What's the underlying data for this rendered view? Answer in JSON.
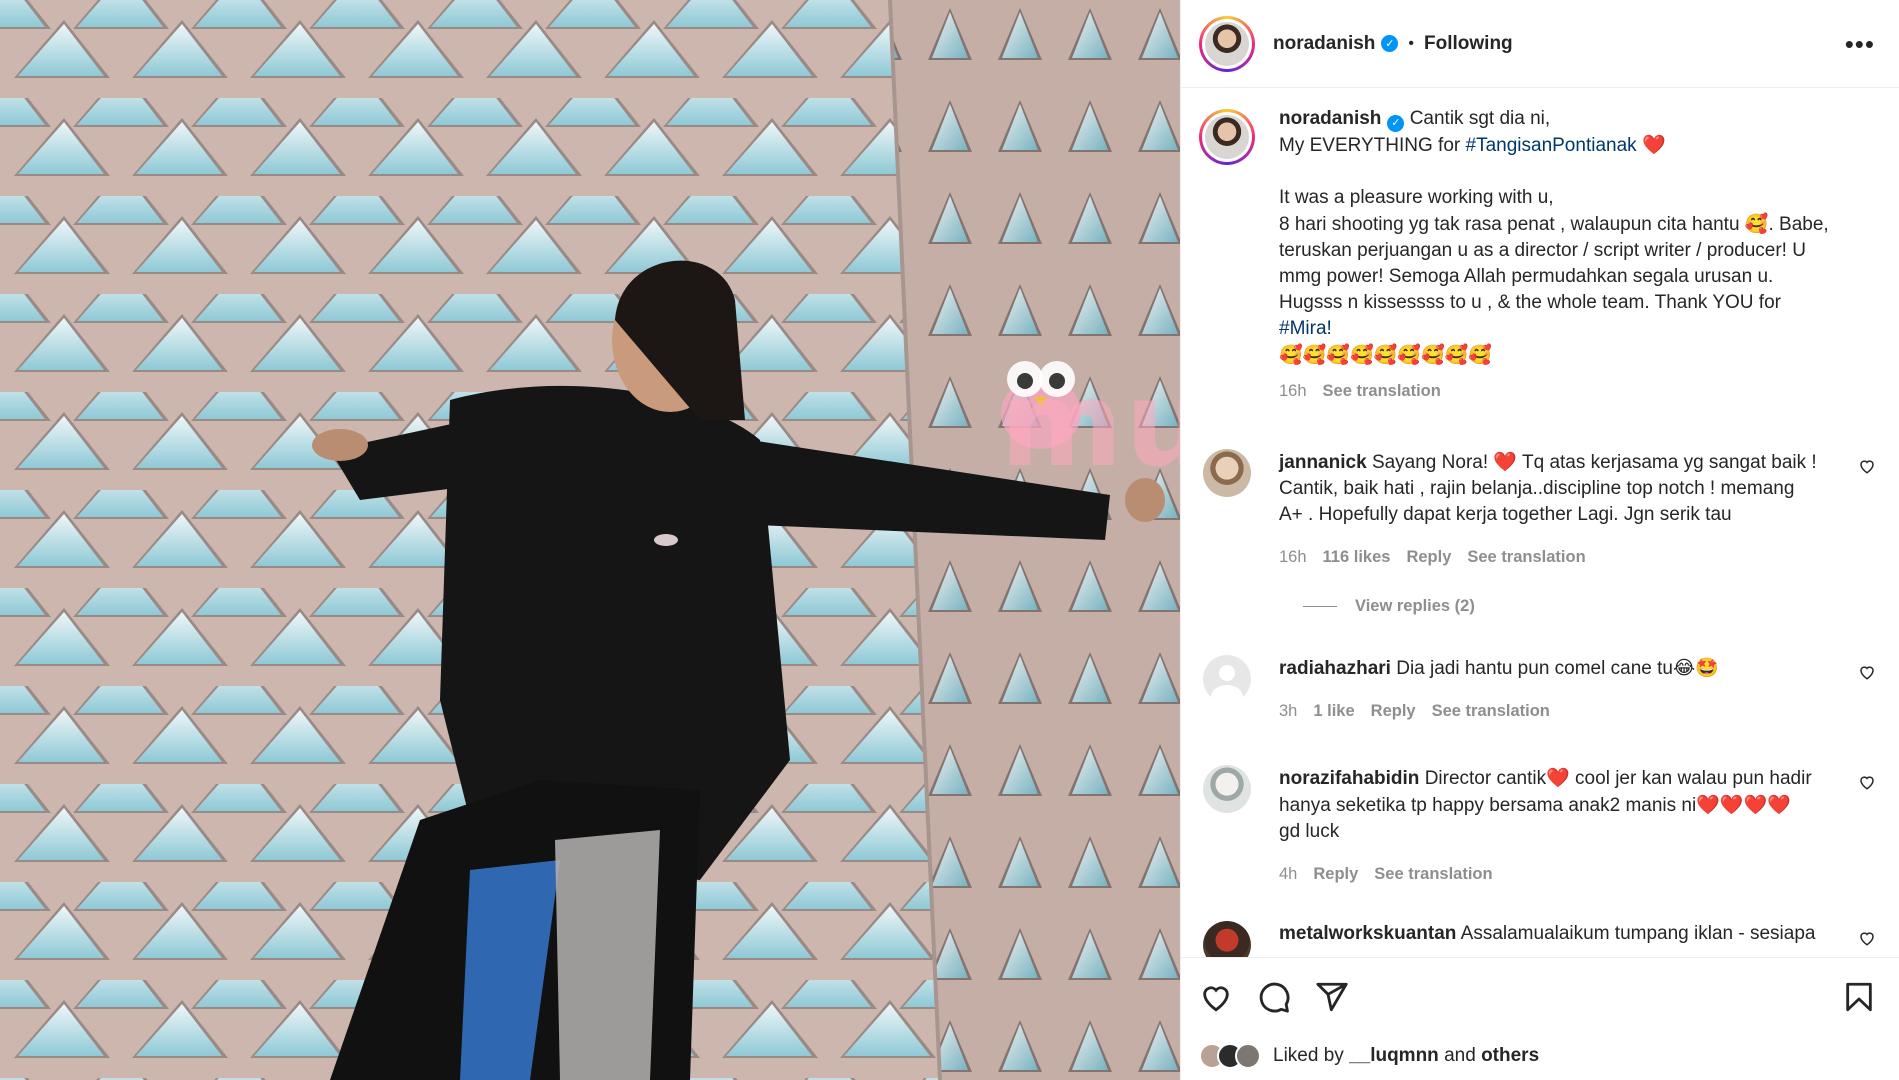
{
  "post": {
    "username": "noradanish",
    "verified": true,
    "follow_status": "Following",
    "separator": "•",
    "more_icon": "more-horizontal-icon"
  },
  "caption": {
    "username": "noradanish",
    "line1": "Cantik sgt dia ni,",
    "line2_prefix": "My EVERYTHING for ",
    "line2_hashtag": "#TangisanPontianak",
    "line2_emoji": "❤️",
    "para_a": "It was a pleasure working with u,",
    "para_b1": "8 hari shooting yg tak rasa penat , walaupun cita hantu ",
    "para_b1_emoji": "🥰",
    "para_b2": ". Babe,",
    "para_c": "teruskan perjuangan u as a director / script writer / producer! U",
    "para_d": "mmg power! Semoga Allah permudahkan segala urusan u.",
    "para_e": "Hugsss n kissessss to u , & the whole team. Thank YOU for",
    "para_f_hashtag": "#Mira!",
    "emoji_row": "🥰🥰🥰🥰🥰🥰🥰🥰🥰",
    "time": "16h",
    "see_translation": "See translation"
  },
  "comments": [
    {
      "username": "jannanick",
      "text_1": "Sayang Nora! ",
      "text_heart": "❤️",
      "text_2": " Tq atas kerjasama yg sangat baik !",
      "text_line2": "Cantik, baik hati , rajin belanja..discipline top notch ! memang",
      "text_line3": "A+ . Hopefully dapat kerja together Lagi. Jgn serik tau",
      "time": "16h",
      "likes": "116 likes",
      "reply": "Reply",
      "see_translation": "See translation"
    },
    {
      "username": "radiahazhari",
      "text": "Dia jadi hantu pun comel cane tu",
      "emoji": "😂🤩",
      "time": "3h",
      "likes": "1 like",
      "reply": "Reply",
      "see_translation": "See translation"
    },
    {
      "username": "norazifahabidin",
      "text_1": "Director cantik",
      "heart": "❤️",
      "text_2": " cool jer kan walau pun hadir",
      "text_line2": "hanya seketika tp happy bersama anak2 manis ni",
      "hearts": "❤️❤️❤️❤️",
      "text_line3": "gd luck",
      "time": "4h",
      "reply": "Reply",
      "see_translation": "See translation"
    },
    {
      "username": "metalworkskuantan",
      "text": "Assalamualaikum tumpang iklan  - sesiapa"
    }
  ],
  "view_replies": "View replies (2)",
  "liked_by": {
    "prefix": "Liked by ",
    "user": "__luqmnn",
    "mid": " and ",
    "others": "others"
  },
  "watermark": "murai",
  "icons": [
    "heart-icon",
    "comment-icon",
    "share-icon",
    "bookmark-icon"
  ]
}
